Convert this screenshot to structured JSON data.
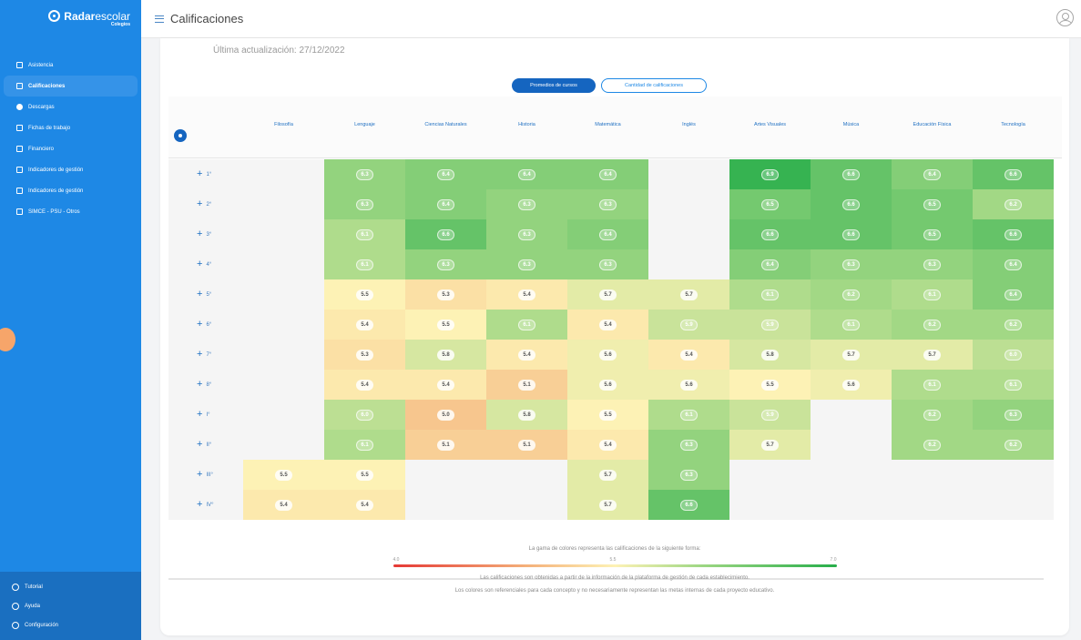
{
  "app": {
    "brand_bold": "Radar",
    "brand_light": "escolar",
    "brand_sub": "Colegios"
  },
  "header": {
    "title": "Calificaciones"
  },
  "sidebar": {
    "items": [
      {
        "label": "Asistencia",
        "icon": "calendar-icon",
        "active": false
      },
      {
        "label": "Calificaciones",
        "icon": "grid-icon",
        "active": true
      },
      {
        "label": "Descargas",
        "icon": "download-icon",
        "active": false
      },
      {
        "label": "Fichas de trabajo",
        "icon": "worksheet-icon",
        "active": false
      },
      {
        "label": "Financiero",
        "icon": "finance-icon",
        "active": false
      },
      {
        "label": "Indicadores de gestión",
        "icon": "indicators-icon",
        "active": false
      },
      {
        "label": "Indicadores de gestión",
        "icon": "indicators-icon",
        "active": false
      },
      {
        "label": "SIMCE - PSU - Otros",
        "icon": "exam-icon",
        "active": false
      }
    ],
    "bottom": [
      {
        "label": "Tutorial",
        "icon": "tutorial-icon"
      },
      {
        "label": "Ayuda",
        "icon": "help-icon"
      },
      {
        "label": "Configuración",
        "icon": "settings-icon"
      }
    ]
  },
  "main": {
    "updated": "Última actualización: 27/12/2022",
    "toggle_active": "Promedios de cursos",
    "toggle_inactive": "Cantidad de calificaciones"
  },
  "table": {
    "subjects": [
      "Filosofía",
      "Lenguaje",
      "Ciencias Naturales",
      "Historia",
      "Matemática",
      "Inglés",
      "Artes Visuales",
      "Música",
      "Educación Física",
      "Tecnología"
    ],
    "rows": [
      {
        "label": "1°",
        "values": [
          null,
          6.3,
          6.4,
          6.4,
          6.4,
          null,
          6.9,
          6.6,
          6.4,
          6.6
        ]
      },
      {
        "label": "2°",
        "values": [
          null,
          6.3,
          6.4,
          6.3,
          6.3,
          null,
          6.5,
          6.6,
          6.5,
          6.2
        ]
      },
      {
        "label": "3°",
        "values": [
          null,
          6.1,
          6.6,
          6.3,
          6.4,
          null,
          6.6,
          6.6,
          6.5,
          6.6
        ]
      },
      {
        "label": "4°",
        "values": [
          null,
          6.1,
          6.3,
          6.3,
          6.3,
          null,
          6.4,
          6.3,
          6.3,
          6.4
        ]
      },
      {
        "label": "5°",
        "values": [
          null,
          5.5,
          5.3,
          5.4,
          5.7,
          5.7,
          6.1,
          6.2,
          6.1,
          6.4
        ]
      },
      {
        "label": "6°",
        "values": [
          null,
          5.4,
          5.5,
          6.1,
          5.4,
          5.9,
          5.9,
          6.1,
          6.2,
          6.2
        ]
      },
      {
        "label": "7°",
        "values": [
          null,
          5.3,
          5.8,
          5.4,
          5.6,
          5.4,
          5.8,
          5.7,
          5.7,
          6.0
        ]
      },
      {
        "label": "8°",
        "values": [
          null,
          5.4,
          5.4,
          5.1,
          5.6,
          5.6,
          5.5,
          5.6,
          6.1,
          6.1
        ]
      },
      {
        "label": "I°",
        "values": [
          null,
          6.0,
          5.0,
          5.8,
          5.5,
          6.1,
          5.9,
          null,
          6.2,
          6.3
        ]
      },
      {
        "label": "II°",
        "values": [
          null,
          6.1,
          5.1,
          5.1,
          5.4,
          6.3,
          5.7,
          null,
          6.2,
          6.2
        ]
      },
      {
        "label": "III°",
        "values": [
          5.5,
          5.5,
          null,
          null,
          5.7,
          6.3,
          null,
          null,
          null,
          null
        ]
      },
      {
        "label": "IV°",
        "values": [
          5.4,
          5.4,
          null,
          null,
          5.7,
          6.6,
          null,
          null,
          null,
          null
        ]
      }
    ]
  },
  "legend": {
    "description": "La gama de colores representa las calificaciones de la siguiente forma:",
    "min": "4.0",
    "mid": "5.5",
    "max": "7.0",
    "note1": "Las calificaciones son obtenidas a partir de la información de la plataforma de gestión de cada establecimiento.",
    "note2": "Los colores son referenciales para cada concepto y no necesariamente representan las metas internas de cada proyecto educativo.",
    "colors": [
      "#e53935",
      "#f4b07a",
      "#fdf2b5",
      "#9bd682",
      "#27ae4a"
    ]
  }
}
